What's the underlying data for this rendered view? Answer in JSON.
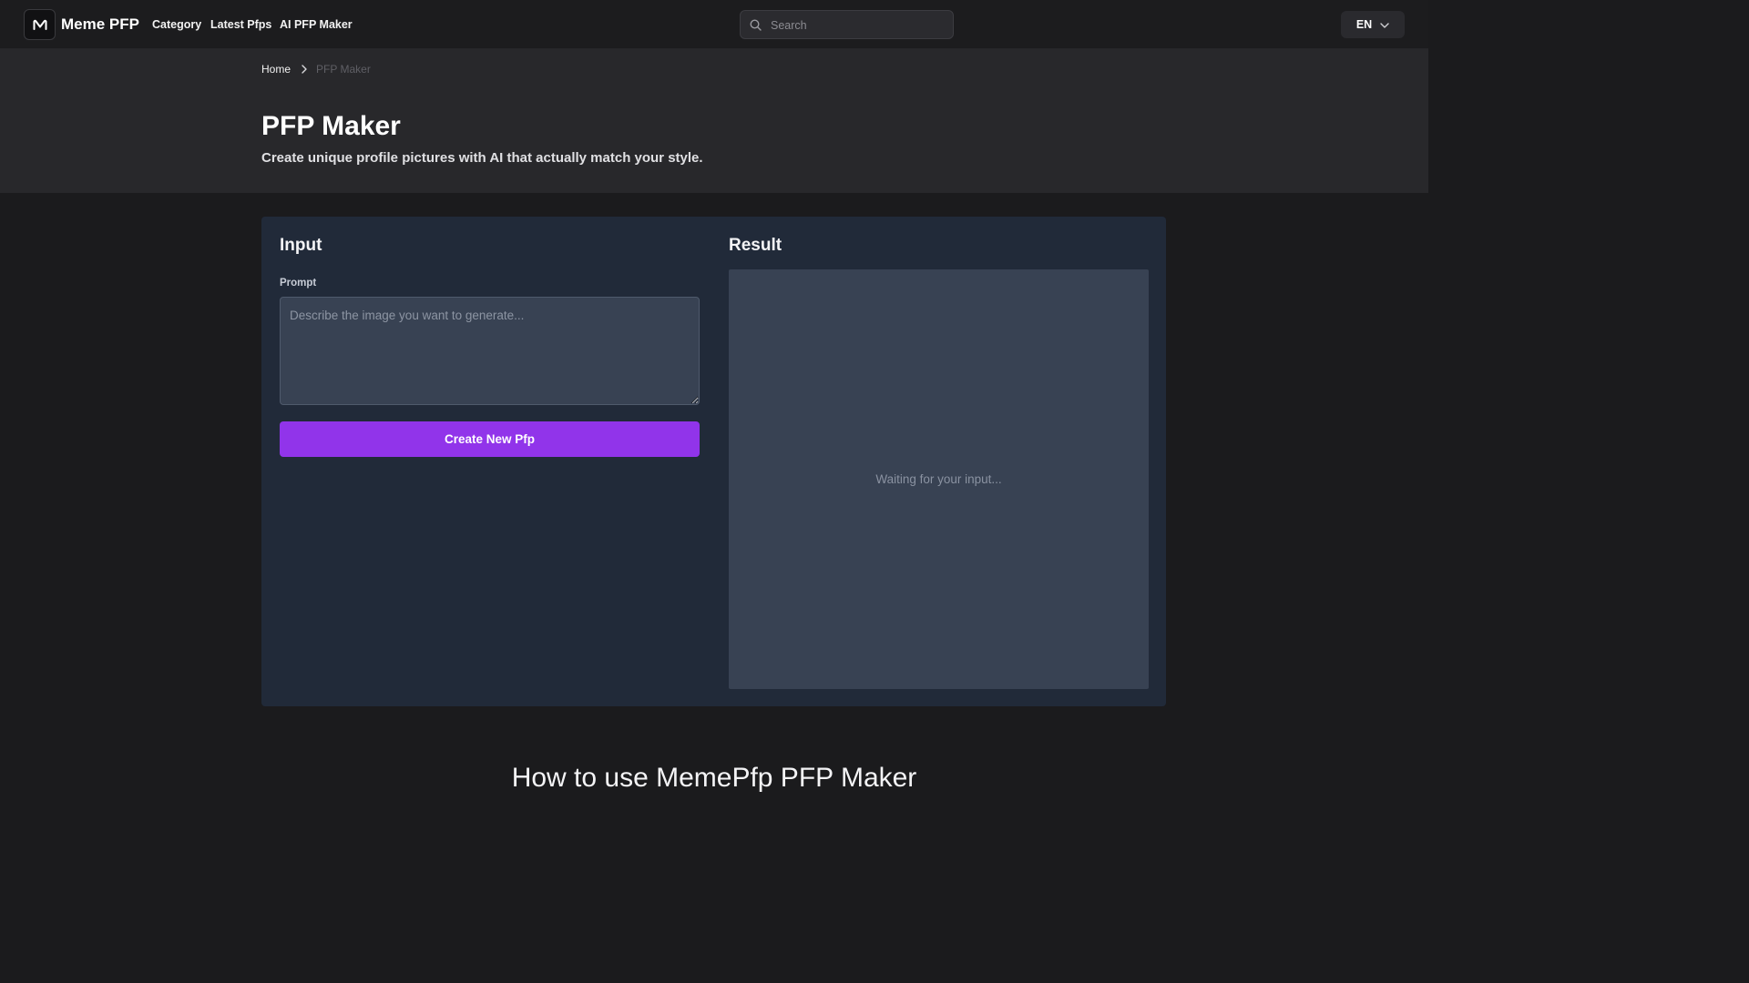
{
  "header": {
    "brand": "Meme PFP",
    "logo_letter": "M",
    "nav": [
      "Category",
      "Latest Pfps",
      "AI PFP Maker"
    ],
    "search_placeholder": "Search",
    "language": "EN"
  },
  "breadcrumb": {
    "home": "Home",
    "current": "PFP Maker"
  },
  "hero": {
    "title": "PFP Maker",
    "subtitle": "Create unique profile pictures with AI that actually match your style."
  },
  "input_panel": {
    "title": "Input",
    "prompt_label": "Prompt",
    "prompt_placeholder": "Describe the image you want to generate...",
    "prompt_value": "",
    "button_label": "Create New Pfp"
  },
  "result_panel": {
    "title": "Result",
    "waiting_text": "Waiting for your input..."
  },
  "how_to": {
    "title": "How to use MemePfp PFP Maker"
  },
  "colors": {
    "accent": "#9134ea",
    "card_bg": "#212a39",
    "field_bg": "#384253"
  },
  "icons": {
    "search": "search-icon",
    "breadcrumb_separator": "chevron-right-icon",
    "language_dropdown": "chevron-down-icon",
    "logo": "logo-icon"
  }
}
